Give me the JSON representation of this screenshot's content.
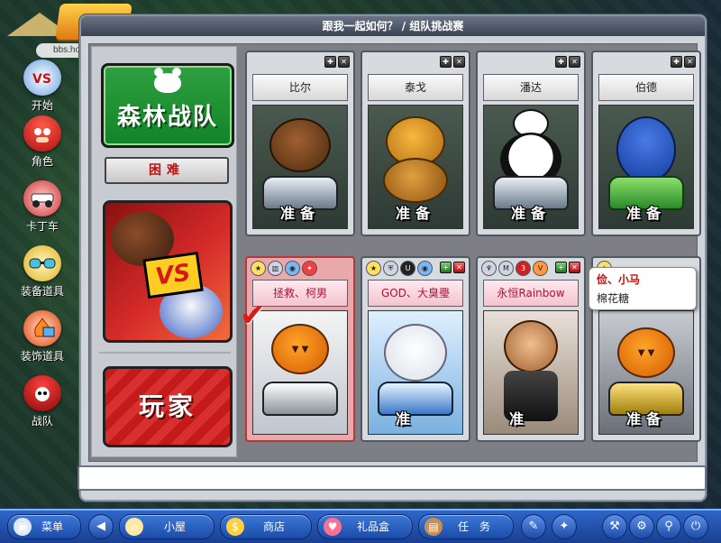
{
  "logo": {
    "url_text": "bbs.houdao.com"
  },
  "window": {
    "title": "跟我一起如何？ / 组队挑战赛"
  },
  "sidebar": {
    "items": [
      {
        "label": "开始",
        "icon": "vs-start-icon"
      },
      {
        "label": "角色",
        "icon": "mushroom-character-icon"
      },
      {
        "label": "卡丁车",
        "icon": "kart-icon"
      },
      {
        "label": "装备道具",
        "icon": "goggles-icon"
      },
      {
        "label": "装饰道具",
        "icon": "flame-shirt-icon"
      },
      {
        "label": "战队",
        "icon": "team-skull-icon"
      }
    ]
  },
  "left_panel": {
    "team_label": "森林战队",
    "difficulty_label": "困难",
    "vs_text": "VS",
    "player_label": "玩家"
  },
  "slots": [
    {
      "name": "比尔",
      "status": "准备"
    },
    {
      "name": "泰戈",
      "status": "准备"
    },
    {
      "name": "潘达",
      "status": "准备"
    },
    {
      "name": "伯德",
      "status": "准备"
    },
    {
      "name": "拯救、柯男",
      "status": ""
    },
    {
      "name": "GOD、大臭璺",
      "status": "准"
    },
    {
      "name": "永恒Rainbow",
      "status": "准"
    },
    {
      "name": "小马",
      "status": "准备"
    }
  ],
  "tooltip": {
    "line1": "俭、小马",
    "line2": "棉花糖"
  },
  "taskbar": {
    "menu_label": "菜单",
    "house_label": "小屋",
    "shop_label": "商店",
    "gift_label": "礼品盒",
    "task_label": "任　务"
  },
  "colors": {
    "ready_text": "#ffffff",
    "selected_slot": "#e9a8aa",
    "team_green": "#128428",
    "player_red": "#c41a1a"
  }
}
